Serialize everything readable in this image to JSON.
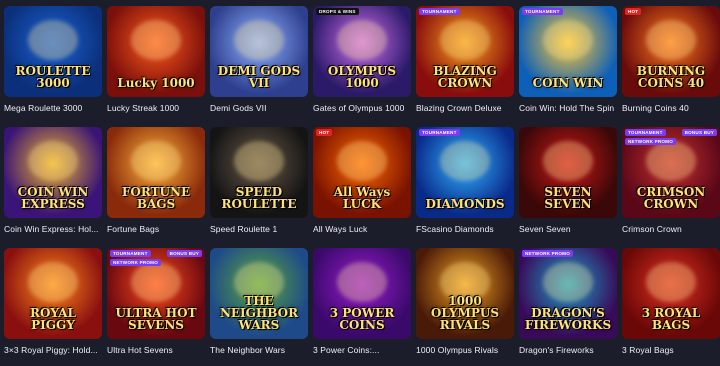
{
  "games": [
    {
      "name": "Mega Roulette 3000",
      "art_title": "ROULETTE 3000",
      "colors": [
        "#0b2f7a",
        "#1a63d6"
      ],
      "badges": []
    },
    {
      "name": "Lucky Streak 1000",
      "art_title": "Lucky 1000",
      "colors": [
        "#7a0f0b",
        "#ff5a1c"
      ],
      "badges": []
    },
    {
      "name": "Demi Gods VII",
      "art_title": "DEMI GODS VII",
      "colors": [
        "#2e3f8f",
        "#8fb2ff"
      ],
      "badges": []
    },
    {
      "name": "Gates of Olympus 1000",
      "art_title": "OLYMPUS 1000",
      "colors": [
        "#2a1a68",
        "#d06ef0"
      ],
      "badges": [
        {
          "text": "DROPS & WINS",
          "color": "#111111"
        }
      ]
    },
    {
      "name": "Blazing Crown Deluxe",
      "art_title": "BLAZING CROWN",
      "colors": [
        "#8a0d0d",
        "#f7a11a"
      ],
      "badges": [
        {
          "text": "TOURNAMENT",
          "color": "#7a3cf0"
        }
      ]
    },
    {
      "name": "Coin Win: Hold The Spin",
      "art_title": "COIN WIN",
      "colors": [
        "#0e5fb8",
        "#ffc934"
      ],
      "badges": [
        {
          "text": "TOURNAMENT",
          "color": "#7a3cf0"
        }
      ]
    },
    {
      "name": "Burning Coins 40",
      "art_title": "BURNING COINS 40",
      "colors": [
        "#6a0b0b",
        "#ff7a1c"
      ],
      "badges": [
        {
          "text": "HOT",
          "color": "#e02424"
        }
      ]
    },
    {
      "name": "Coin Win Express: Hol...",
      "art_title": "COIN WIN EXPRESS",
      "colors": [
        "#3a1478",
        "#f0b428"
      ],
      "badges": []
    },
    {
      "name": "Fortune Bags",
      "art_title": "FORTUNE BAGS",
      "colors": [
        "#8a2a0b",
        "#ffb43a"
      ],
      "badges": []
    },
    {
      "name": "Speed Roulette 1",
      "art_title": "SPEED ROULETTE",
      "colors": [
        "#141414",
        "#6a5a4a"
      ],
      "badges": []
    },
    {
      "name": "All Ways Luck",
      "art_title": "All Ways LUCK",
      "colors": [
        "#7a1200",
        "#ff6a00"
      ],
      "badges": [
        {
          "text": "HOT",
          "color": "#e02424"
        }
      ]
    },
    {
      "name": "FScasino Diamonds",
      "art_title": "DIAMONDS",
      "colors": [
        "#0a2a8a",
        "#2fb2ff"
      ],
      "badges": [
        {
          "text": "TOURNAMENT",
          "color": "#7a3cf0"
        }
      ]
    },
    {
      "name": "Seven Seven",
      "art_title": "SEVEN SEVEN",
      "colors": [
        "#3a0808",
        "#d01818"
      ],
      "badges": []
    },
    {
      "name": "Crimson Crown",
      "art_title": "CRIMSON CROWN",
      "colors": [
        "#5a0818",
        "#c83030"
      ],
      "badges": [
        {
          "text": "TOURNAMENT",
          "color": "#7a3cf0"
        },
        {
          "text": "BONUS BUY",
          "color": "#7a3cf0"
        },
        {
          "text": "NETWORK PROMO",
          "color": "#7a3cf0"
        }
      ]
    },
    {
      "name": "3×3 Royal Piggy: Hold...",
      "art_title": "ROYAL PIGGY",
      "colors": [
        "#8a1010",
        "#ff8a1a"
      ],
      "badges": []
    },
    {
      "name": "Ultra Hot Sevens",
      "art_title": "ULTRA HOT SEVENS",
      "colors": [
        "#6a0810",
        "#ff4a1a"
      ],
      "badges": [
        {
          "text": "TOURNAMENT",
          "color": "#7a3cf0"
        },
        {
          "text": "BONUS BUY",
          "color": "#7a3cf0"
        },
        {
          "text": "NETWORK PROMO",
          "color": "#7a3cf0"
        }
      ]
    },
    {
      "name": "The Neighbor Wars",
      "art_title": "THE NEIGHBOR WARS",
      "colors": [
        "#1e4a8a",
        "#5aa83a"
      ],
      "badges": []
    },
    {
      "name": "3 Power Coins:...",
      "art_title": "3 POWER COINS",
      "colors": [
        "#3a0a6a",
        "#9a1ad0"
      ],
      "badges": []
    },
    {
      "name": "1000 Olympus Rivals",
      "art_title": "1000 OLYMPUS RIVALS",
      "colors": [
        "#4a1a08",
        "#f0a020"
      ],
      "badges": []
    },
    {
      "name": "Dragon's Fireworks",
      "art_title": "DRAGON'S FIREWORKS",
      "colors": [
        "#3a0a5a",
        "#1aa0c8"
      ],
      "badges": [
        {
          "text": "NETWORK PROMO",
          "color": "#7a3cf0"
        }
      ]
    },
    {
      "name": "3 Royal Bags",
      "art_title": "3 ROYAL BAGS",
      "colors": [
        "#6a0808",
        "#e03020"
      ],
      "badges": []
    }
  ]
}
